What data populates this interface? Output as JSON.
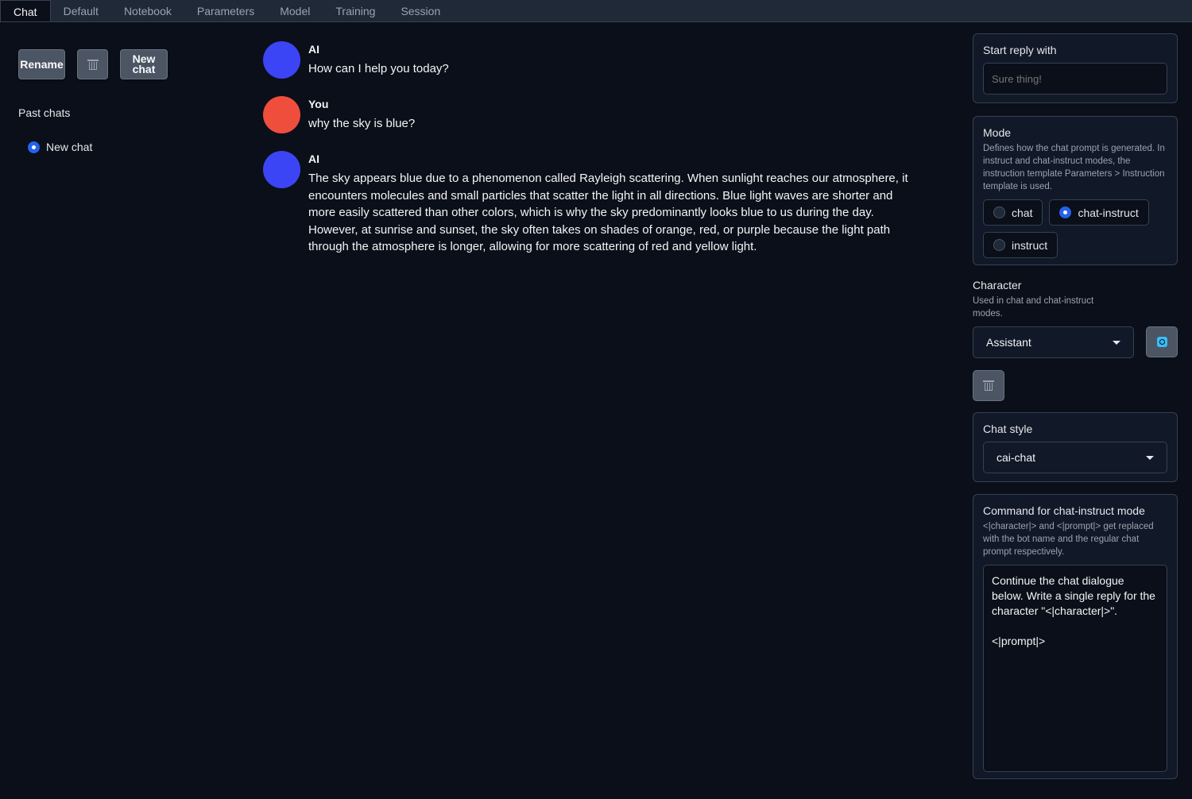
{
  "tabs": [
    "Chat",
    "Default",
    "Notebook",
    "Parameters",
    "Model",
    "Training",
    "Session"
  ],
  "active_tab": "Chat",
  "left": {
    "rename_label": "Rename",
    "new_chat_line1": "New",
    "new_chat_line2": "chat",
    "past_chats_label": "Past chats",
    "past_chats": [
      {
        "label": "New chat",
        "selected": true
      }
    ]
  },
  "messages": [
    {
      "sender": "AI",
      "text": "How can I help you today?",
      "avatar_color": "#3b45f5"
    },
    {
      "sender": "You",
      "text": "why the sky is blue?",
      "avatar_color": "#ef4e3d"
    },
    {
      "sender": "AI",
      "text": "The sky appears blue due to a phenomenon called Rayleigh scattering. When sunlight reaches our atmosphere, it encounters molecules and small particles that scatter the light in all directions. Blue light waves are shorter and more easily scattered than other colors, which is why the sky predominantly looks blue to us during the day. However, at sunrise and sunset, the sky often takes on shades of orange, red, or purple because the light path through the atmosphere is longer, allowing for more scattering of red and yellow light.",
      "avatar_color": "#3b45f5"
    }
  ],
  "start_reply": {
    "title": "Start reply with",
    "placeholder": "Sure thing!"
  },
  "mode": {
    "title": "Mode",
    "description": "Defines how the chat prompt is generated. In instruct and chat-instruct modes, the instruction template Parameters > Instruction template is used.",
    "options": [
      "chat",
      "chat-instruct",
      "instruct"
    ],
    "selected": "chat-instruct"
  },
  "character": {
    "title": "Character",
    "description": "Used in chat and chat-instruct modes.",
    "value": "Assistant"
  },
  "chat_style": {
    "title": "Chat style",
    "value": "cai-chat"
  },
  "command": {
    "title": "Command for chat-instruct mode",
    "description": "<|character|> and <|prompt|> get replaced with the bot name and the regular chat prompt respectively.",
    "value": "Continue the chat dialogue below. Write a single reply for the character \"<|character|>\".\n\n<|prompt|>"
  },
  "colors": {
    "accent": "#2563eb",
    "background": "#0b0f19",
    "panel": "#111827"
  }
}
